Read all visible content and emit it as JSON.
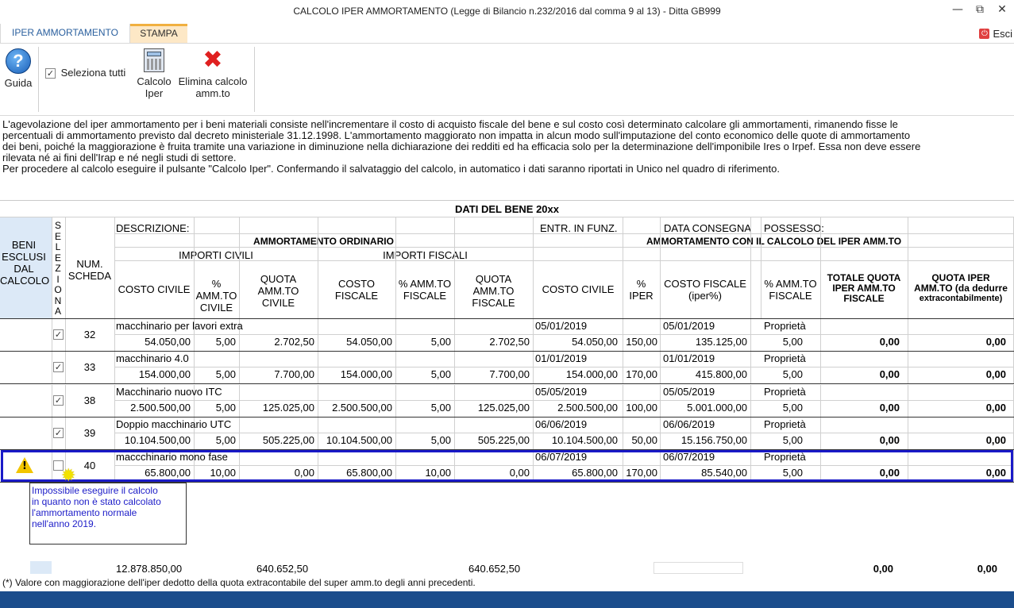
{
  "window": {
    "title": "CALCOLO IPER AMMORTAMENTO (Legge di Bilancio n.232/2016 dal comma 9 al 13) - Ditta GB999",
    "minimize": "—",
    "restore": "⧉",
    "close": "✕"
  },
  "tabs": {
    "iper": "IPER AMMORTAMENTO",
    "stampa": "STAMPA",
    "esci": "Esci"
  },
  "ribbon": {
    "guida": "Guida",
    "seleziona_tutti": "Seleziona tutti",
    "calcolo_line1": "Calcolo",
    "calcolo_line2": "Iper",
    "elimina_line1": "Elimina calcolo",
    "elimina_line2": "amm.to"
  },
  "info": {
    "l1": "L'agevolazione del iper ammortamento per i beni materiali consiste nell'incrementare il costo di acquisto fiscale del bene e sul costo così determinato calcolare gli ammortamenti, rimanendo fisse le",
    "l2": "percentuali di ammortamento previsto dal decreto ministeriale 31.12.1998. L'ammortamento maggiorato non impatta in alcun modo sull'imputazione del conto economico delle quote di ammortamento",
    "l3": "dei beni, poiché la maggiorazione è fruita tramite una variazione in diminuzione nella dichiarazione dei redditi ed ha efficacia solo per la determinazione dell'imponibile Ires o Irpef. Essa non deve essere",
    "l4": "rilevata né ai fini dell'Irap e né negli studi di settore.",
    "l5": "Per procedere al calcolo eseguire il pulsante \"Calcolo Iper\". Confermando il salvataggio del calcolo, in automatico i dati saranno riportati in Unico nel quadro di riferimento."
  },
  "header": {
    "dati_bene": "DATI DEL BENE 20xx",
    "beni_esclusi": [
      "BENI",
      "ESCLUSI",
      "DAL",
      "CALCOLO"
    ],
    "seleziona": [
      "S",
      "E",
      "L",
      "E",
      "Z",
      "I",
      "O",
      "N",
      "A"
    ],
    "num_scheda": [
      "NUM.",
      "SCHEDA"
    ],
    "descrizione": "DESCRIZIONE:",
    "entr_funz": "ENTR. IN FUNZ.",
    "data_consegna": "DATA CONSEGNA",
    "possesso": "POSSESSO:",
    "amm_ordinario": "AMMORTAMENTO ORDINARIO",
    "amm_iper": "AMMORTAMENTO CON IL CALCOLO DEL IPER AMM.TO",
    "importi_civili": "IMPORTI CIVILI",
    "importi_fiscali": "IMPORTI FISCALI",
    "costo_civile": "COSTO CIVILE",
    "amm_civile": [
      "%",
      "AMM.TO",
      "CIVILE"
    ],
    "quota_civile": [
      "QUOTA",
      "AMM.TO",
      "CIVILE"
    ],
    "costo_fiscale": [
      "COSTO",
      "FISCALE"
    ],
    "amm_fiscale": [
      "% AMM.TO",
      "FISCALE"
    ],
    "quota_fiscale": [
      "QUOTA",
      "AMM.TO",
      "FISCALE"
    ],
    "costo_civile2": "COSTO CIVILE",
    "iper_pct": [
      "%",
      "IPER"
    ],
    "costo_fiscale_iper": [
      "COSTO FISCALE",
      "(iper%)"
    ],
    "amm_fiscale2": [
      "% AMM.TO",
      "FISCALE"
    ],
    "totale_quota": [
      "TOTALE QUOTA",
      "IPER AMM.TO",
      "FISCALE"
    ],
    "quota_iper": [
      "QUOTA IPER",
      "AMM.TO (da dedurre",
      "extracontabilmente)"
    ]
  },
  "rows": [
    {
      "checked": "✓",
      "num": "32",
      "desc": "macchinario per lavori extra",
      "entr": "05/01/2019",
      "consegna": "05/01/2019",
      "possesso": "Proprietà",
      "costo_civile": "54.050,00",
      "amm_civile": "5,00",
      "quota_civile": "2.702,50",
      "costo_fiscale": "54.050,00",
      "amm_fiscale": "5,00",
      "quota_fiscale": "2.702,50",
      "costo_civile2": "54.050,00",
      "iper": "150,00",
      "costo_fiscale_iper": "135.125,00",
      "amm_fiscale2": "5,00",
      "totale": "0,00",
      "quota_iper": "0,00"
    },
    {
      "checked": "✓",
      "num": "33",
      "desc": "macchinario 4.0",
      "entr": "01/01/2019",
      "consegna": "01/01/2019",
      "possesso": "Proprietà",
      "costo_civile": "154.000,00",
      "amm_civile": "5,00",
      "quota_civile": "7.700,00",
      "costo_fiscale": "154.000,00",
      "amm_fiscale": "5,00",
      "quota_fiscale": "7.700,00",
      "costo_civile2": "154.000,00",
      "iper": "170,00",
      "costo_fiscale_iper": "415.800,00",
      "amm_fiscale2": "5,00",
      "totale": "0,00",
      "quota_iper": "0,00"
    },
    {
      "checked": "✓",
      "num": "38",
      "desc": "Macchinario nuovo ITC",
      "entr": "05/05/2019",
      "consegna": "05/05/2019",
      "possesso": "Proprietà",
      "costo_civile": "2.500.500,00",
      "amm_civile": "5,00",
      "quota_civile": "125.025,00",
      "costo_fiscale": "2.500.500,00",
      "amm_fiscale": "5,00",
      "quota_fiscale": "125.025,00",
      "costo_civile2": "2.500.500,00",
      "iper": "100,00",
      "costo_fiscale_iper": "5.001.000,00",
      "amm_fiscale2": "5,00",
      "totale": "0,00",
      "quota_iper": "0,00"
    },
    {
      "checked": "✓",
      "num": "39",
      "desc": "Doppio macchinario UTC",
      "entr": "06/06/2019",
      "consegna": "06/06/2019",
      "possesso": "Proprietà",
      "costo_civile": "10.104.500,00",
      "amm_civile": "5,00",
      "quota_civile": "505.225,00",
      "costo_fiscale": "10.104.500,00",
      "amm_fiscale": "5,00",
      "quota_fiscale": "505.225,00",
      "costo_civile2": "10.104.500,00",
      "iper": "50,00",
      "costo_fiscale_iper": "15.156.750,00",
      "amm_fiscale2": "5,00",
      "totale": "0,00",
      "quota_iper": "0,00"
    },
    {
      "checked": "",
      "num": "40",
      "desc": "maccchinario mono fase",
      "entr": "06/07/2019",
      "consegna": "06/07/2019",
      "possesso": "Proprietà",
      "costo_civile": "65.800,00",
      "amm_civile": "10,00",
      "quota_civile": "0,00",
      "costo_fiscale": "65.800,00",
      "amm_fiscale": "10,00",
      "quota_fiscale": "0,00",
      "costo_civile2": "65.800,00",
      "iper": "170,00",
      "costo_fiscale_iper": "85.540,00",
      "amm_fiscale2": "5,00",
      "totale": "0,00",
      "quota_iper": "0,00"
    }
  ],
  "warning_tooltip": [
    "Impossibile eseguire il calcolo",
    "in quanto non è stato calcolato",
    "l'ammortamento normale",
    "nell'anno 2019."
  ],
  "totals": {
    "costo_civile": "12.878.850,00",
    "quota_civile": "640.652,50",
    "quota_fiscale": "640.652,50",
    "totale": "0,00",
    "quota_iper": "0,00"
  },
  "footnote": "(*) Valore con maggiorazione dell'iper dedotto della quota extracontabile del super amm.to degli anni precedenti.",
  "colors": {
    "accent": "#2a5f9e",
    "selection": "#1a1ac8",
    "warning": "#f2c500",
    "footer": "#1b4d8c"
  }
}
